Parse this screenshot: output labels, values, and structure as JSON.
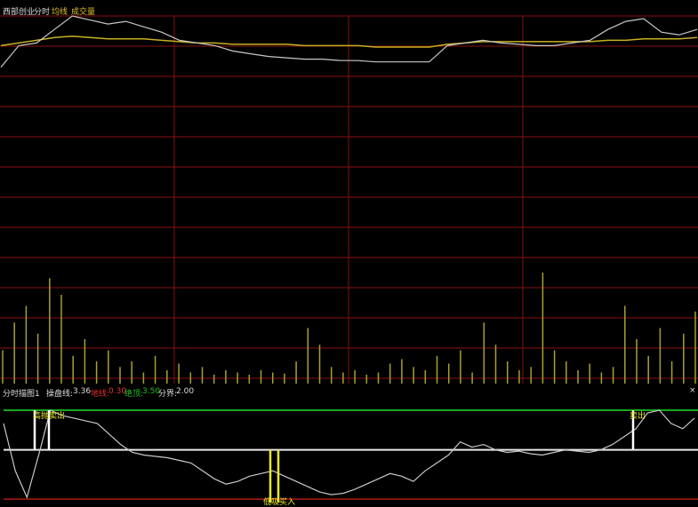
{
  "header": {
    "stock_name": "西部创业",
    "tab_intraday": "分时",
    "legend_avg": "均线",
    "legend_volume": "成交量"
  },
  "indicator": {
    "name": "分时描图1",
    "caopan_label": "操盘线:",
    "caopan_value": "3.36",
    "dixian_label": "地线:",
    "dixian_value": "0.30",
    "jueding_label": "绝顶:",
    "jueding_value": "3.50",
    "fenjie_label": "分界:",
    "fenjie_value": "2.00",
    "signal_top_left": "高抛卖出",
    "signal_top_right": "卖出",
    "signal_bottom": "低吸买入",
    "close_icon": "×"
  },
  "colors": {
    "price": "#c8c8c8",
    "avg": "#c8b020",
    "volume": "#a8a030",
    "grid": "#8a1010",
    "top_line": "#18a818",
    "mid_line": "#e8e8e8",
    "bottom_line": "#b01818",
    "signal_white": "#ffffff",
    "signal_yellow": "#e8e830",
    "label_dixian": "#e03030",
    "label_jueding": "#20c020",
    "label_avg": "#e0c030",
    "label_volume": "#e0c030"
  },
  "chart_data": [
    {
      "type": "line",
      "series": [
        {
          "values": [
            0.62,
            0.78,
            0.8,
            0.9,
            1.0,
            0.97,
            0.94,
            0.96,
            0.92,
            0.88,
            0.82,
            0.8,
            0.78,
            0.74,
            0.72,
            0.7,
            0.69,
            0.68,
            0.68,
            0.67,
            0.67,
            0.66,
            0.66,
            0.66,
            0.66,
            0.78,
            0.8,
            0.82,
            0.8,
            0.79,
            0.78,
            0.78,
            0.8,
            0.82,
            0.9,
            0.96,
            0.98,
            0.88,
            0.86,
            0.9
          ]
        },
        {
          "values": [
            0.78,
            0.8,
            0.82,
            0.84,
            0.85,
            0.84,
            0.83,
            0.83,
            0.83,
            0.82,
            0.81,
            0.8,
            0.8,
            0.79,
            0.79,
            0.79,
            0.79,
            0.78,
            0.78,
            0.78,
            0.78,
            0.77,
            0.77,
            0.77,
            0.77,
            0.79,
            0.8,
            0.81,
            0.81,
            0.81,
            0.81,
            0.81,
            0.81,
            0.81,
            0.82,
            0.82,
            0.83,
            0.83,
            0.83,
            0.84
          ]
        }
      ]
    },
    {
      "type": "bar",
      "values": [
        0.3,
        0.55,
        0.7,
        0.45,
        0.95,
        0.8,
        0.25,
        0.4,
        0.2,
        0.3,
        0.15,
        0.2,
        0.1,
        0.25,
        0.12,
        0.18,
        0.1,
        0.15,
        0.08,
        0.12,
        0.1,
        0.08,
        0.12,
        0.1,
        0.09,
        0.2,
        0.5,
        0.35,
        0.15,
        0.1,
        0.12,
        0.08,
        0.1,
        0.18,
        0.22,
        0.15,
        0.12,
        0.25,
        0.18,
        0.3,
        0.1,
        0.55,
        0.35,
        0.2,
        0.12,
        0.15,
        1.0,
        0.3,
        0.2,
        0.12,
        0.18,
        0.1,
        0.15,
        0.7,
        0.4,
        0.25,
        0.5,
        0.2,
        0.45,
        0.65
      ]
    },
    {
      "type": "line",
      "series": [
        {
          "values": [
            3.0,
            1.2,
            0.2,
            1.8,
            3.5,
            3.3,
            3.2,
            3.1,
            3.0,
            2.6,
            2.2,
            1.9,
            1.8,
            1.75,
            1.7,
            1.6,
            1.5,
            1.2,
            0.9,
            0.7,
            0.8,
            1.0,
            1.1,
            1.2,
            1.0,
            0.8,
            0.6,
            0.4,
            0.3,
            0.35,
            0.5,
            0.7,
            0.9,
            1.1,
            1.0,
            0.8,
            1.2,
            1.5,
            1.8,
            2.3,
            2.1,
            2.2,
            2.0,
            1.9,
            1.95,
            1.85,
            1.8,
            1.9,
            2.0,
            1.95,
            1.9,
            2.0,
            2.2,
            2.5,
            2.8,
            3.4,
            3.5,
            3.0,
            2.8,
            3.2
          ]
        }
      ],
      "levels": {
        "jueding": 3.5,
        "fenjie": 2.0,
        "dixian": 0.3
      }
    }
  ]
}
